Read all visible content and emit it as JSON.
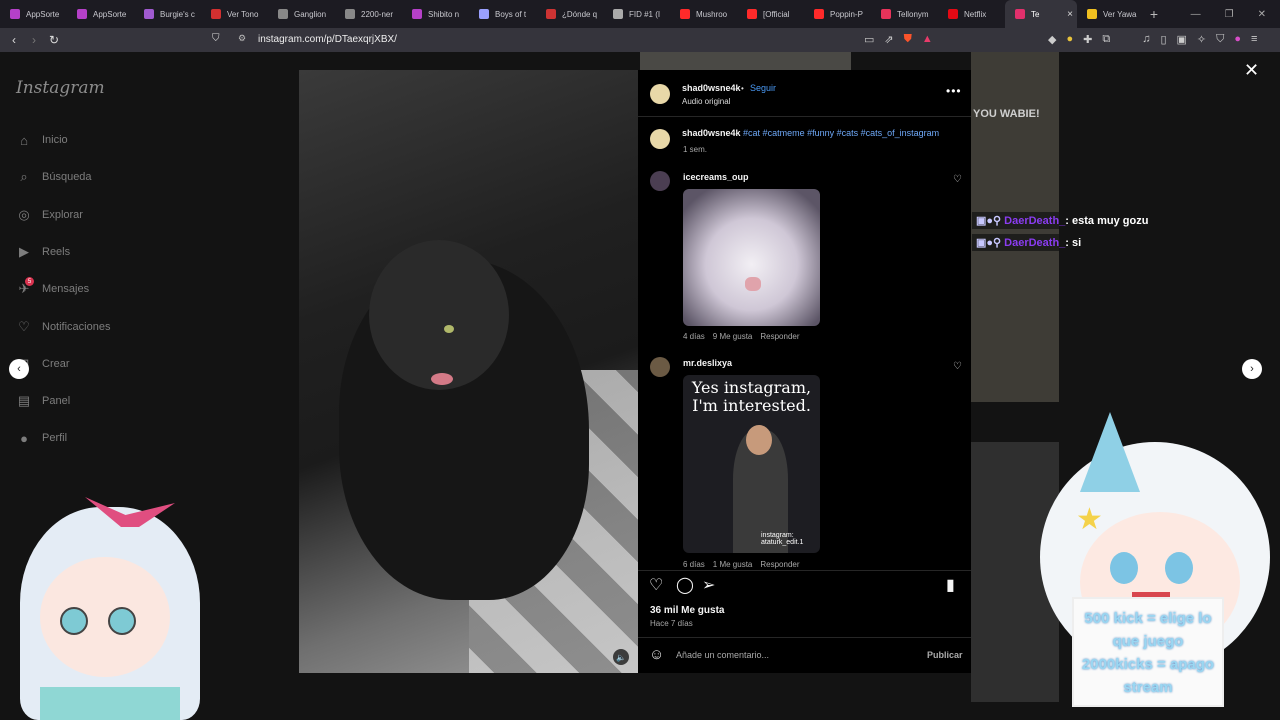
{
  "browser": {
    "tabs": [
      {
        "label": "AppSorte",
        "color": "#b540c8"
      },
      {
        "label": "AppSorte",
        "color": "#b540c8"
      },
      {
        "label": "Burgie's c",
        "color": "#a05ad0"
      },
      {
        "label": "Ver Tono",
        "color": "#d13030"
      },
      {
        "label": "Ganglion",
        "color": "#888888"
      },
      {
        "label": "2200-ner",
        "color": "#888888"
      },
      {
        "label": "Shibito n",
        "color": "#b540c8"
      },
      {
        "label": "Boys of t",
        "color": "#9aa0ff"
      },
      {
        "label": "¿Dónde q",
        "color": "#cc3333"
      },
      {
        "label": "FID #1 (I",
        "color": "#aaaaaa"
      },
      {
        "label": "Mushroo",
        "color": "#ff2a2a"
      },
      {
        "label": "[Official",
        "color": "#ff2a2a"
      },
      {
        "label": "Poppin-P",
        "color": "#ff2a2a"
      },
      {
        "label": "Tellonym",
        "color": "#e8335a"
      },
      {
        "label": "Netflix",
        "color": "#e50914"
      },
      {
        "label": "Te",
        "color": "#e1306c",
        "active": true
      },
      {
        "label": "Ver Yawa",
        "color": "#f0c020"
      }
    ],
    "url": "instagram.com/p/DTaexqrjXBX/"
  },
  "sidebar": {
    "logo": "Instagram",
    "items": [
      {
        "label": "Inicio",
        "icon": "home-icon"
      },
      {
        "label": "Búsqueda",
        "icon": "search-icon"
      },
      {
        "label": "Explorar",
        "icon": "compass-icon"
      },
      {
        "label": "Reels",
        "icon": "reels-icon"
      },
      {
        "label": "Mensajes",
        "icon": "messenger-icon",
        "badge": "5"
      },
      {
        "label": "Notificaciones",
        "icon": "heart-icon"
      },
      {
        "label": "Crear",
        "icon": "plus-icon"
      },
      {
        "label": "Panel",
        "icon": "dashboard-icon"
      },
      {
        "label": "Perfil",
        "icon": "profile-icon"
      }
    ]
  },
  "post": {
    "author": "shad0wsne4k",
    "follow": "Seguir",
    "dot": "•",
    "audio": "Audio original",
    "caption_user": "shad0wsne4k",
    "caption_tags": "#cat #catmeme #funny #cats #cats_of_instagram",
    "caption_time": "1 sem.",
    "comments": [
      {
        "user": "icecreams_oup",
        "time": "4 días",
        "likes": "9 Me gusta",
        "reply": "Responder"
      },
      {
        "user": "mr.deslixya",
        "image_text": "Yes instagram, I'm interested.",
        "watermark": "instagram: ataturk_edit.1",
        "time": "6 días",
        "likes": "1 Me gusta",
        "reply": "Responder"
      }
    ],
    "likes": "36 mil Me gusta",
    "ago": "Hace 7 días",
    "comment_placeholder": "Añade un comentario...",
    "publish": "Publicar"
  },
  "chat": [
    {
      "user": "DaerDeath_",
      "msg": ": esta muy gozu"
    },
    {
      "user": "DaerDeath_",
      "msg": ": si"
    }
  ],
  "stream_overlay": {
    "top_text": "YOU WABIE!",
    "line1": "500 kick = elige lo",
    "line2": "que juego",
    "line3": "2000kicks = apago",
    "line4": "stream"
  }
}
